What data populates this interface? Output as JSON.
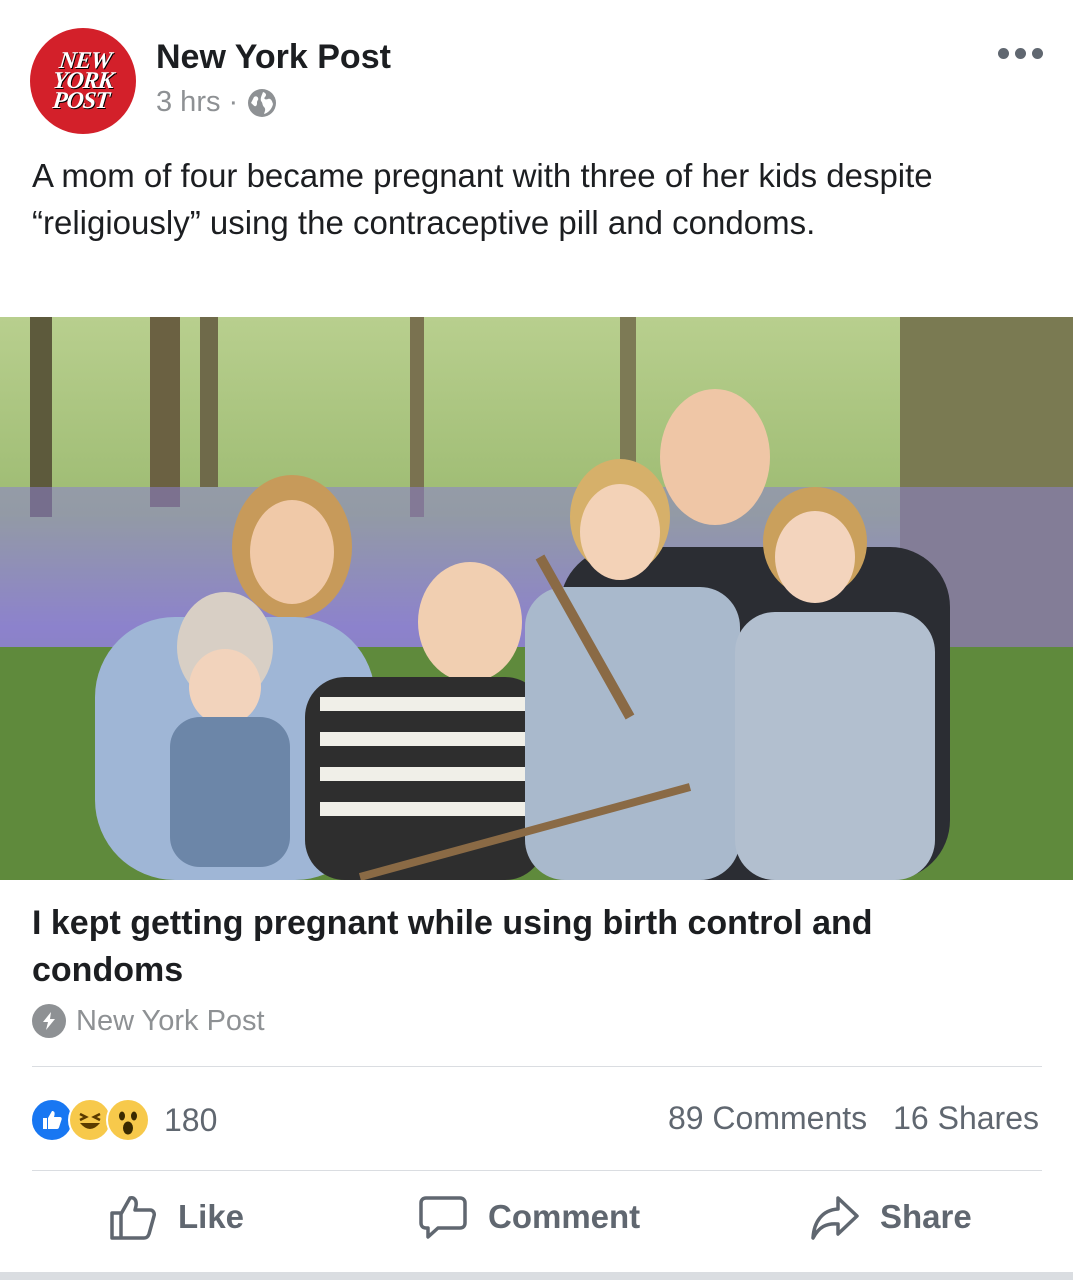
{
  "post": {
    "page_name": "New York Post",
    "avatar_text": "NEW\nYORK\nPOST",
    "time": "3 hrs",
    "separator": "·",
    "privacy_icon": "globe-icon",
    "body": "A mom of four became pregnant with three of her kids despite “religiously” using the contraceptive pill and condoms."
  },
  "link": {
    "title": "I kept getting pregnant while using birth control and condoms",
    "source": "New York Post",
    "source_icon": "instant-article-icon"
  },
  "engagement": {
    "reaction_icons": [
      "like-icon",
      "haha-icon",
      "wow-icon"
    ],
    "reaction_count": "180",
    "comments": "89 Comments",
    "shares": "16 Shares"
  },
  "actions": {
    "like_label": "Like",
    "comment_label": "Comment",
    "share_label": "Share"
  },
  "colors": {
    "brand_red": "#d3202a",
    "like_blue": "#1877f2",
    "reaction_yellow": "#f7c94b",
    "meta_gray": "#8e9194"
  }
}
